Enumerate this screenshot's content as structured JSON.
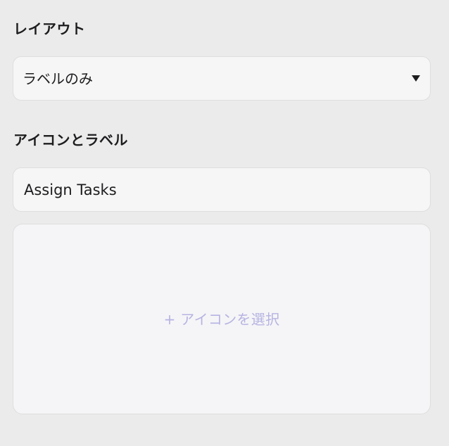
{
  "layout_section": {
    "title": "レイアウト",
    "select": {
      "value": "ラベルのみ",
      "caret_icon": "triangle-down"
    }
  },
  "icon_label_section": {
    "title": "アイコンとラベル",
    "label_input": {
      "value": "Assign Tasks"
    },
    "icon_picker": {
      "label": "+ アイコンを選択",
      "label_color": "#b6b3e2"
    }
  },
  "colors": {
    "background": "#ebebeb",
    "field_background": "#f6f6f6",
    "field_border": "#dedede",
    "text": "#1d1d1f"
  }
}
